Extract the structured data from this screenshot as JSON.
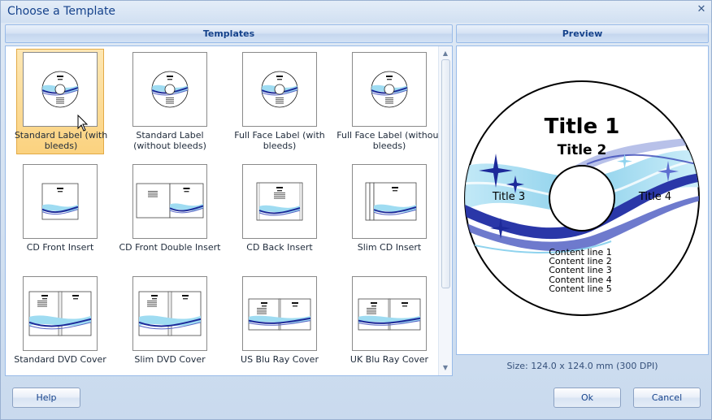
{
  "window": {
    "title": "Choose a Template",
    "close_glyph": "✕"
  },
  "templates": {
    "header": "Templates",
    "items": [
      {
        "label": "Standard Label (with bleeds)",
        "kind": "disc",
        "selected": true
      },
      {
        "label": "Standard Label (without bleeds)",
        "kind": "disc",
        "selected": false
      },
      {
        "label": "Full Face Label (with bleeds)",
        "kind": "disc-full",
        "selected": false
      },
      {
        "label": "Full Face Label (without bleeds)",
        "kind": "disc-full",
        "selected": false
      },
      {
        "label": "CD Front Insert",
        "kind": "cd-front",
        "selected": false
      },
      {
        "label": "CD Front Double Insert",
        "kind": "cd-double",
        "selected": false
      },
      {
        "label": "CD Back Insert",
        "kind": "cd-back",
        "selected": false
      },
      {
        "label": "Slim CD Insert",
        "kind": "slim-cd",
        "selected": false
      },
      {
        "label": "Standard DVD Cover",
        "kind": "dvd",
        "selected": false
      },
      {
        "label": "Slim DVD Cover",
        "kind": "slim-dvd",
        "selected": false
      },
      {
        "label": "US Blu Ray Cover",
        "kind": "bluray",
        "selected": false
      },
      {
        "label": "UK Blu Ray Cover",
        "kind": "bluray-uk",
        "selected": false
      }
    ]
  },
  "preview": {
    "header": "Preview",
    "title1": "Title 1",
    "title2": "Title 2",
    "title3": "Title 3",
    "title4": "Title 4",
    "content_lines": [
      "Content line 1",
      "Content line 2",
      "Content line 3",
      "Content line 4",
      "Content line 5"
    ],
    "size_text": "Size: 124.0 x 124.0 mm (300 DPI)"
  },
  "buttons": {
    "help": "Help",
    "ok": "Ok",
    "cancel": "Cancel"
  },
  "icons": {
    "close": "close-icon",
    "scroll_up": "scroll-up-arrow-icon",
    "scroll_down": "scroll-down-arrow-icon",
    "cursor": "mouse-pointer-icon"
  },
  "colors": {
    "accent_blue": "#15428b",
    "wave_dark": "#1d2a9a",
    "wave_light": "#8fd3ee",
    "selection": "#fbd27f"
  }
}
